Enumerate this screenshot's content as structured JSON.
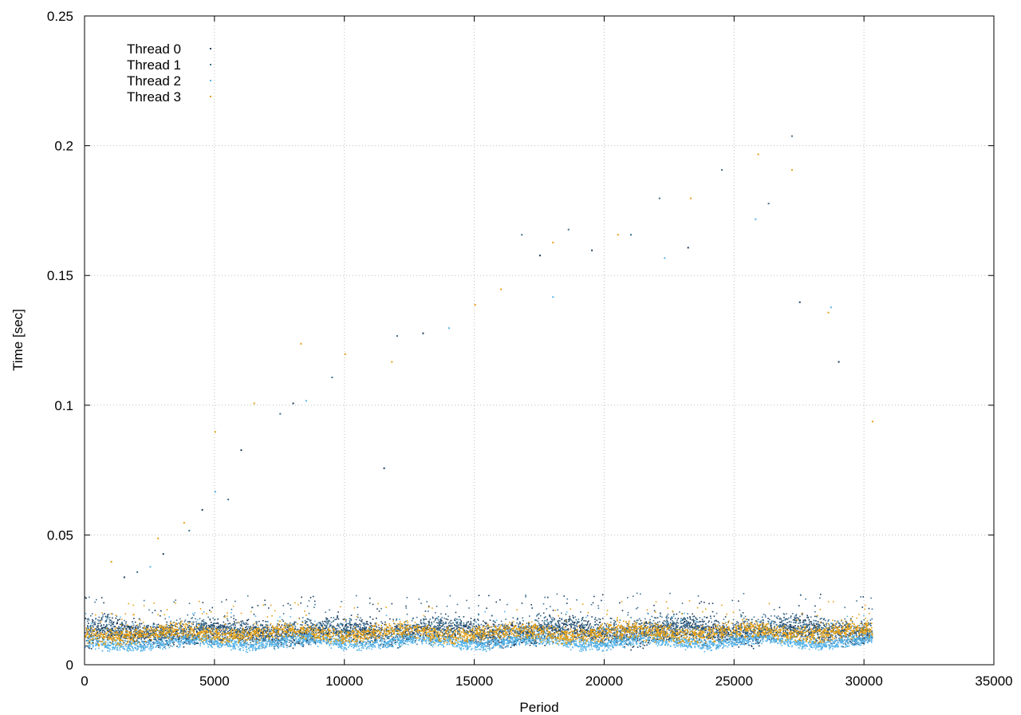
{
  "chart_data": {
    "type": "scatter",
    "title": "",
    "xlabel": "Period",
    "ylabel": "Time [sec]",
    "xlim": [
      0,
      35000
    ],
    "ylim": [
      0,
      0.25
    ],
    "x_ticks": [
      0,
      5000,
      10000,
      15000,
      20000,
      25000,
      30000,
      35000
    ],
    "y_ticks": [
      0,
      0.05,
      0.1,
      0.15,
      0.2,
      0.25
    ],
    "x_tick_labels": [
      "0",
      "5000",
      "10000",
      "15000",
      "20000",
      "25000",
      "30000",
      "35000"
    ],
    "y_tick_labels": [
      "0",
      "0.05",
      "0.1",
      "0.15",
      "0.2",
      "0.25"
    ],
    "grid": true,
    "legend_position": "top-left",
    "series": [
      {
        "name": "Thread 0",
        "color": "#1a3b5c",
        "band": [
          [
            0,
            0.0075,
            0.0175
          ],
          [
            2000,
            0.0085,
            0.0165
          ],
          [
            10000,
            0.0085,
            0.017
          ],
          [
            20000,
            0.0085,
            0.0175
          ],
          [
            30300,
            0.009,
            0.0175
          ]
        ],
        "outliers": [
          [
            1500,
            0.034
          ],
          [
            3000,
            0.043
          ],
          [
            4500,
            0.06
          ],
          [
            6000,
            0.083
          ],
          [
            8000,
            0.101
          ],
          [
            11500,
            0.076
          ],
          [
            13000,
            0.128
          ],
          [
            17500,
            0.158
          ],
          [
            19500,
            0.16
          ],
          [
            23200,
            0.161
          ],
          [
            27500,
            0.14
          ],
          [
            29000,
            0.117
          ]
        ]
      },
      {
        "name": "Thread 1",
        "color": "#3c6e8f",
        "band": [
          [
            0,
            0.008,
            0.018
          ],
          [
            2000,
            0.0085,
            0.017
          ],
          [
            10000,
            0.009,
            0.0175
          ],
          [
            20000,
            0.009,
            0.018
          ],
          [
            30300,
            0.0095,
            0.018
          ]
        ],
        "outliers": [
          [
            2000,
            0.036
          ],
          [
            4000,
            0.052
          ],
          [
            5500,
            0.064
          ],
          [
            7500,
            0.097
          ],
          [
            9500,
            0.111
          ],
          [
            12000,
            0.127
          ],
          [
            16800,
            0.166
          ],
          [
            18600,
            0.168
          ],
          [
            21000,
            0.166
          ],
          [
            22100,
            0.18
          ],
          [
            24500,
            0.191
          ],
          [
            26300,
            0.178
          ],
          [
            27200,
            0.204
          ]
        ]
      },
      {
        "name": "Thread 2",
        "color": "#56b4e9",
        "band": [
          [
            0,
            0.0055,
            0.0105
          ],
          [
            2000,
            0.0065,
            0.0105
          ],
          [
            10000,
            0.007,
            0.011
          ],
          [
            20000,
            0.007,
            0.011
          ],
          [
            30300,
            0.0075,
            0.011
          ]
        ],
        "outliers": [
          [
            2500,
            0.038
          ],
          [
            5000,
            0.067
          ],
          [
            8500,
            0.102
          ],
          [
            14000,
            0.13
          ],
          [
            18000,
            0.142
          ],
          [
            22300,
            0.157
          ],
          [
            25800,
            0.172
          ],
          [
            28700,
            0.138
          ]
        ]
      },
      {
        "name": "Thread 3",
        "color": "#e6a013",
        "band": [
          [
            0,
            0.008,
            0.015
          ],
          [
            2000,
            0.0095,
            0.015
          ],
          [
            10000,
            0.01,
            0.015
          ],
          [
            20000,
            0.0095,
            0.0155
          ],
          [
            30300,
            0.01,
            0.0155
          ]
        ],
        "outliers": [
          [
            1000,
            0.04
          ],
          [
            2800,
            0.049
          ],
          [
            3800,
            0.055
          ],
          [
            5000,
            0.09
          ],
          [
            6500,
            0.101
          ],
          [
            8300,
            0.124
          ],
          [
            10000,
            0.12
          ],
          [
            11800,
            0.117
          ],
          [
            15000,
            0.139
          ],
          [
            16000,
            0.145
          ],
          [
            18000,
            0.163
          ],
          [
            20500,
            0.166
          ],
          [
            23300,
            0.18
          ],
          [
            25900,
            0.197
          ],
          [
            27200,
            0.191
          ],
          [
            28600,
            0.136
          ],
          [
            30300,
            0.094
          ]
        ]
      }
    ]
  }
}
